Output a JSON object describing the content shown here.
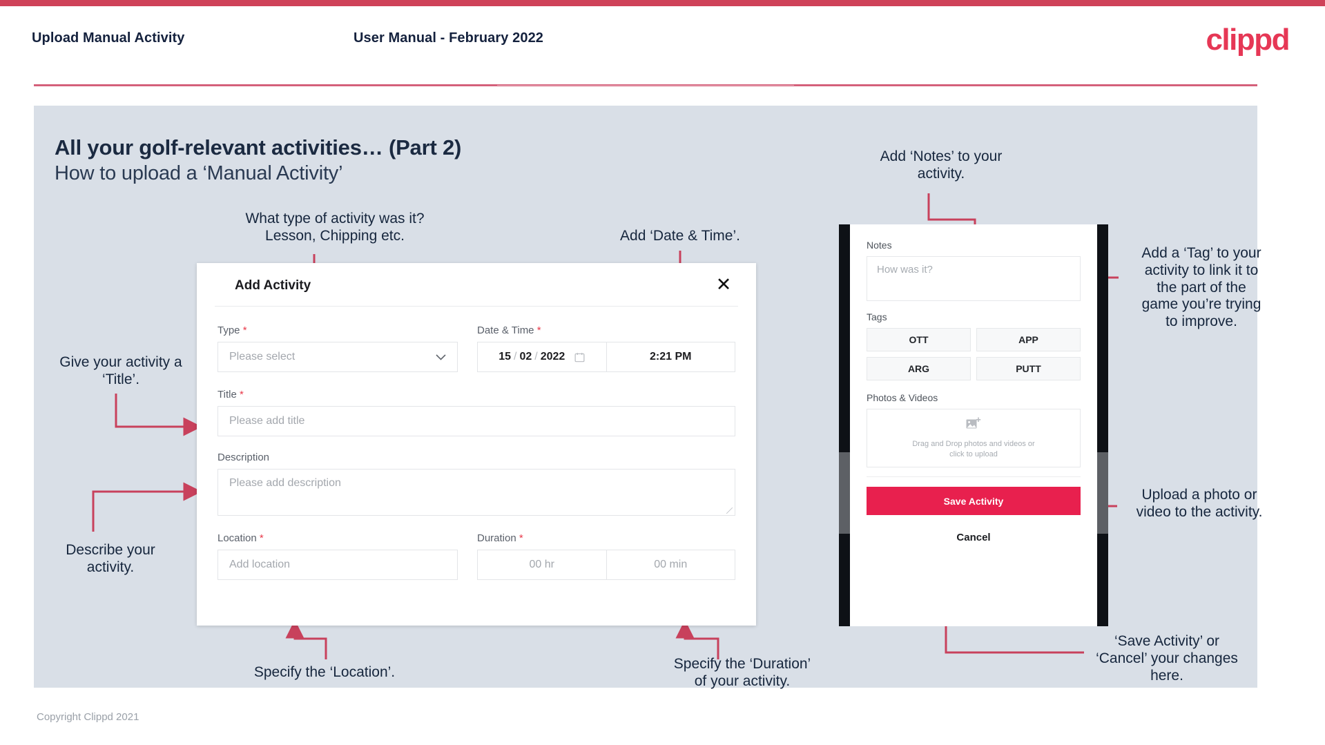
{
  "header": {
    "title": "Upload Manual Activity",
    "subtitle": "User Manual - February 2022",
    "logo": "clippd"
  },
  "slide": {
    "title": "All your golf-relevant activities… (Part 2)",
    "subtitle": "How to upload a ‘Manual Activity’"
  },
  "annotations": {
    "type": "What type of activity was it?\nLesson, Chipping etc.",
    "datetime": "Add ‘Date & Time’.",
    "title": "Give your activity a\n‘Title’.",
    "description": "Describe your\nactivity.",
    "location": "Specify the ‘Location’.",
    "duration": "Specify the ‘Duration’\nof your activity.",
    "notes": "Add ‘Notes’ to your\nactivity.",
    "tags": "Add a ‘Tag’ to your\nactivity to link it to\nthe part of the\ngame you’re trying\nto improve.",
    "upload": "Upload a photo or\nvideo to the activity.",
    "save": "‘Save Activity’ or\n‘Cancel’ your changes\nhere."
  },
  "dialog": {
    "title": "Add Activity",
    "close_icon": "close-icon",
    "fields": {
      "type": {
        "label": "Type",
        "required": "*",
        "placeholder": "Please select",
        "chevron": "chevron-down-icon"
      },
      "datetime": {
        "label": "Date & Time",
        "required": "*",
        "day": "15",
        "month": "02",
        "year": "2022",
        "sep": "/",
        "time": "2:21 PM",
        "calendar_icon": "calendar-icon"
      },
      "title": {
        "label": "Title",
        "required": "*",
        "placeholder": "Please add title"
      },
      "description": {
        "label": "Description",
        "placeholder": "Please add description"
      },
      "location": {
        "label": "Location",
        "required": "*",
        "placeholder": "Add location"
      },
      "duration": {
        "label": "Duration",
        "required": "*",
        "hours_placeholder": "00 hr",
        "minutes_placeholder": "00 min"
      }
    }
  },
  "phone": {
    "notes": {
      "label": "Notes",
      "placeholder": "How was it?"
    },
    "tags": {
      "label": "Tags",
      "items": [
        "OTT",
        "APP",
        "ARG",
        "PUTT"
      ]
    },
    "photos": {
      "label": "Photos & Videos",
      "icon": "add-image-icon",
      "drop_text": "Drag and Drop photos and videos or\nclick to upload"
    },
    "save_label": "Save Activity",
    "cancel_label": "Cancel"
  },
  "footer": {
    "copyright": "Copyright Clippd 2021"
  },
  "colors": {
    "brand": "#e8204e",
    "strip": "#cf4259",
    "arrow": "#c8415c",
    "panel": "#d9dfe7",
    "ink": "#16263d"
  }
}
